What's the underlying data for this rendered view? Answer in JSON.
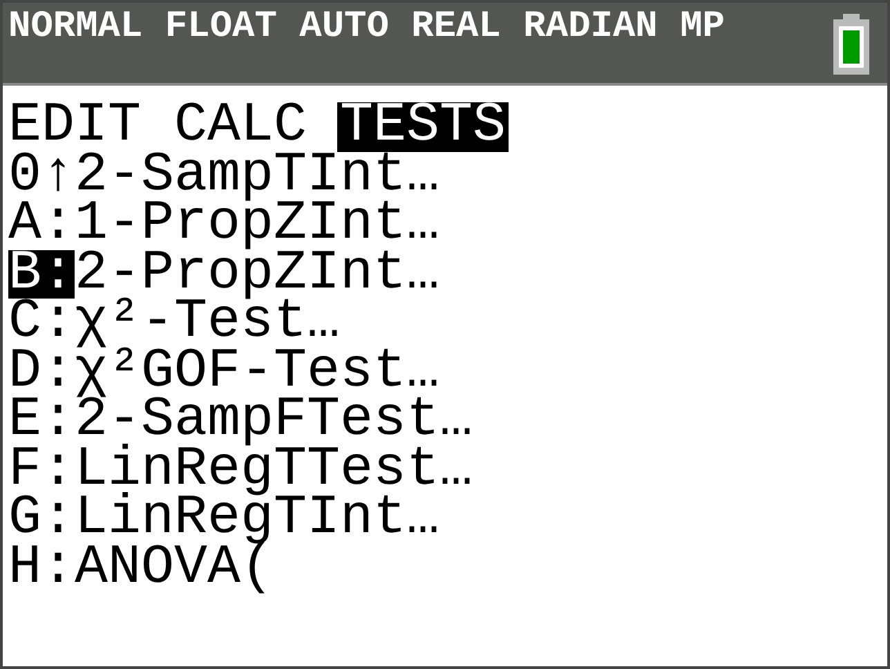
{
  "status_bar": {
    "modes": "NORMAL FLOAT AUTO REAL RADIAN MP"
  },
  "tabs": [
    {
      "label": "EDIT",
      "selected": false
    },
    {
      "label": "CALC",
      "selected": false
    },
    {
      "label": "TESTS",
      "selected": true
    }
  ],
  "items": [
    {
      "key": "0",
      "separator": "↑",
      "label": "2-SampTInt…",
      "selected": false
    },
    {
      "key": "A",
      "separator": ":",
      "label": "1-PropZInt…",
      "selected": false
    },
    {
      "key": "B",
      "separator": ":",
      "label": "2-PropZInt…",
      "selected": true
    },
    {
      "key": "C",
      "separator": ":",
      "label": "χ²-Test…",
      "selected": false
    },
    {
      "key": "D",
      "separator": ":",
      "label": "χ²GOF-Test…",
      "selected": false
    },
    {
      "key": "E",
      "separator": ":",
      "label": "2-SampFTest…",
      "selected": false
    },
    {
      "key": "F",
      "separator": ":",
      "label": "LinRegTTest…",
      "selected": false
    },
    {
      "key": "G",
      "separator": ":",
      "label": "LinRegTInt…",
      "selected": false
    },
    {
      "key": "H",
      "separator": ":",
      "label": "ANOVA(",
      "selected": false
    }
  ]
}
